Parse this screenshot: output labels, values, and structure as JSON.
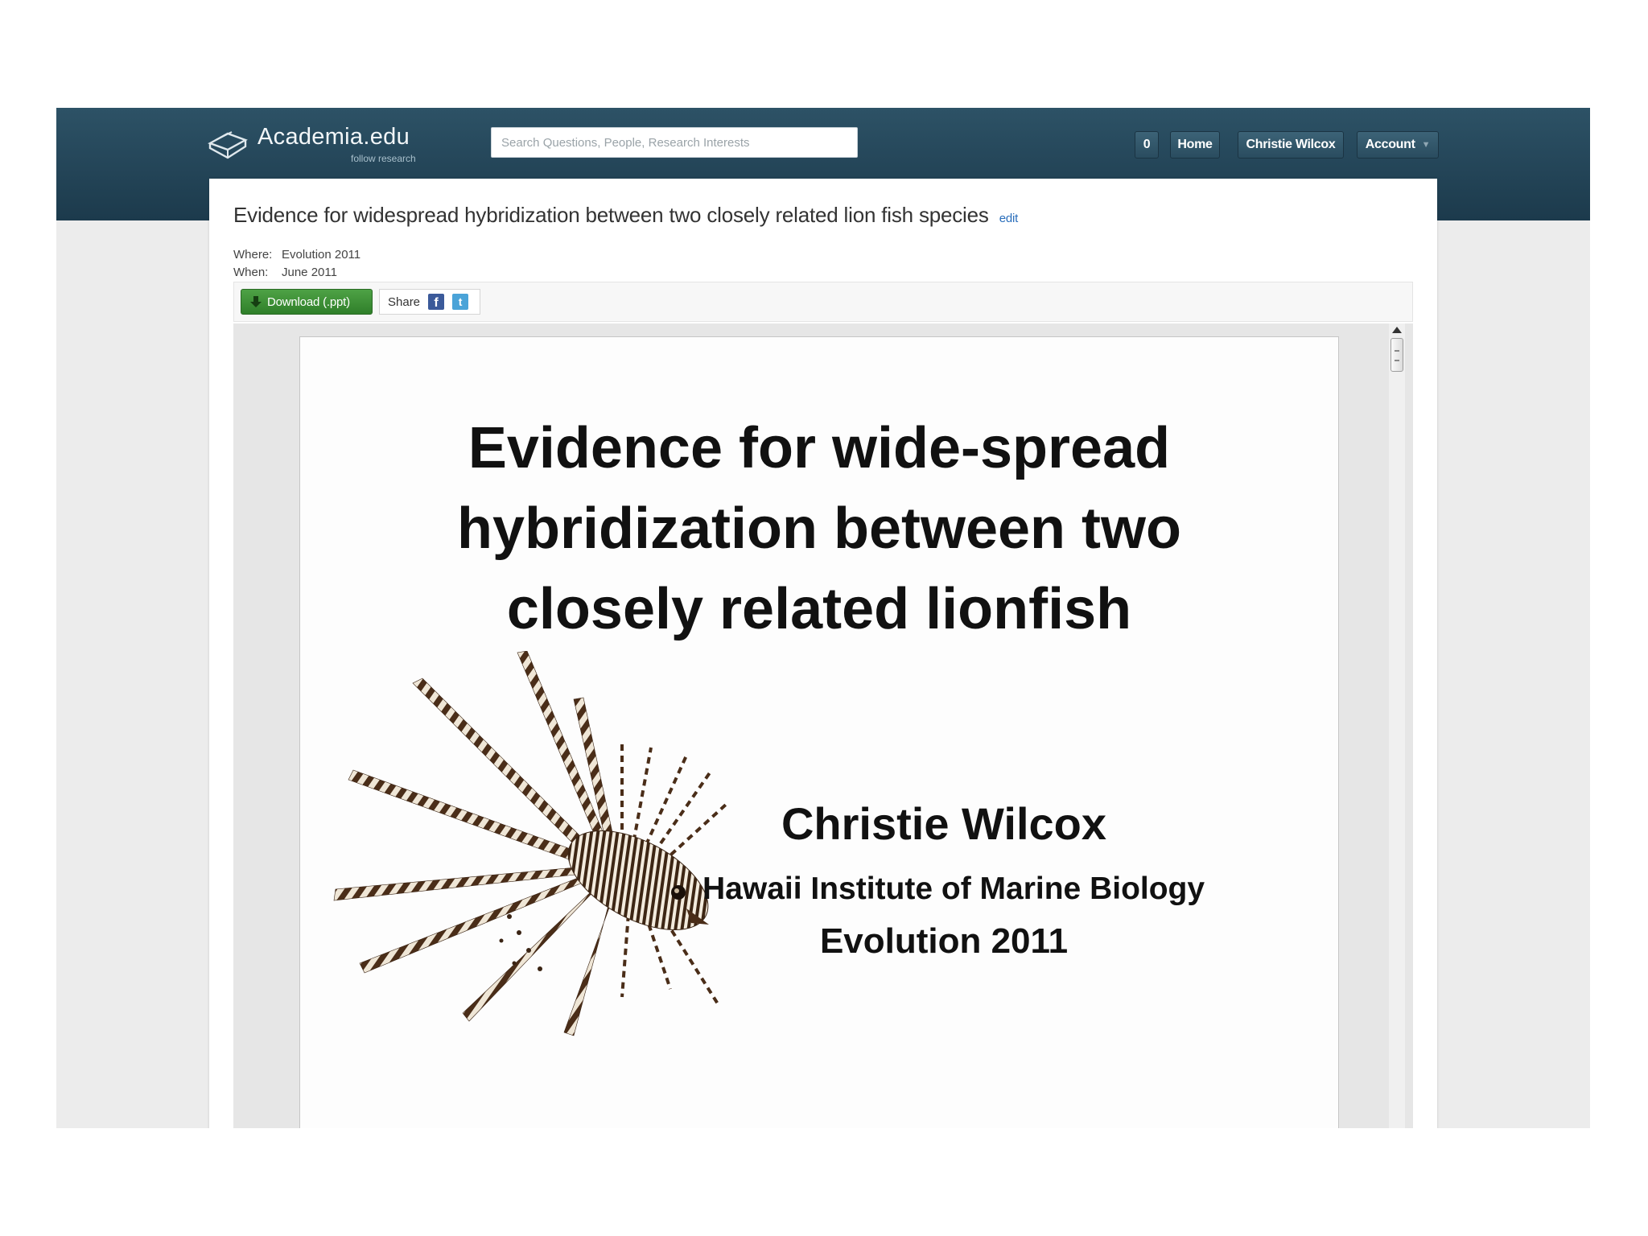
{
  "header": {
    "logo_text": "Academia.edu",
    "logo_tagline": "follow research",
    "search_placeholder": "Search Questions, People, Research Interests",
    "nav": {
      "count": "0",
      "home": "Home",
      "user": "Christie Wilcox",
      "account": "Account"
    }
  },
  "document": {
    "title": "Evidence for widespread hybridization between two closely related lion fish species",
    "edit_label": "edit",
    "where_label": "Where:",
    "where_value": "Evolution 2011",
    "when_label": "When:",
    "when_value": "June 2011"
  },
  "toolbar": {
    "download_label": "Download (.ppt)",
    "share_label": "Share",
    "facebook_glyph": "f",
    "twitter_glyph": "t"
  },
  "slide": {
    "title_lines": [
      "Evidence for wide-spread",
      "hybridization between two",
      "closely related lionfish"
    ],
    "author": "Christie Wilcox",
    "affiliation": "Hawaii Institute of Marine Biology",
    "event": "Evolution 2011"
  },
  "colors": {
    "header_bg": "#24475a",
    "download_green": "#3d9436",
    "facebook_blue": "#3b5a9a",
    "twitter_blue": "#4aa3d8",
    "link_blue": "#2a6ebb"
  },
  "icons": [
    "academia-logo-icon",
    "download-icon",
    "facebook-icon",
    "twitter-icon",
    "dropdown-caret-icon",
    "scroll-up-arrow-icon"
  ]
}
